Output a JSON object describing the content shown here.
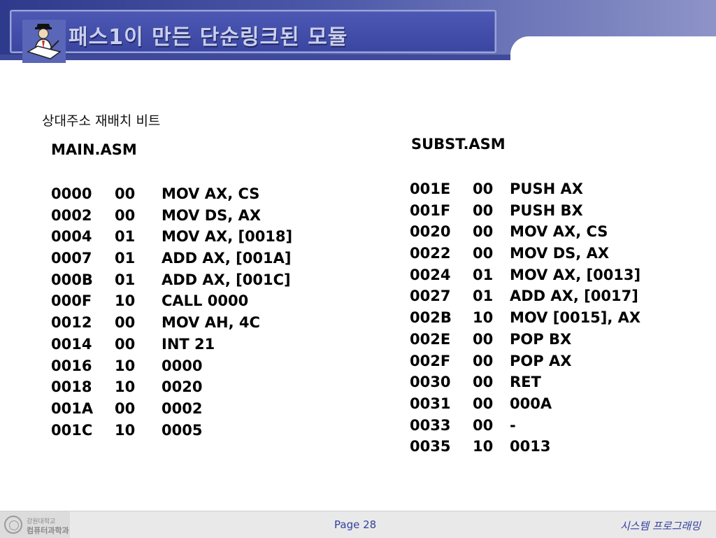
{
  "header": {
    "title": "패스1이 만든 단순링크된 모듈"
  },
  "subtitle": "상대주소  재배치 비트",
  "main_asm": {
    "title": "MAIN.ASM",
    "rows": [
      [
        "0000",
        "00",
        "MOV AX, CS"
      ],
      [
        "0002",
        "00",
        "MOV DS, AX"
      ],
      [
        "0004",
        "01",
        "MOV AX, [0018]"
      ],
      [
        "0007",
        "01",
        "ADD AX, [001A]"
      ],
      [
        "000B",
        "01",
        "ADD AX, [001C]"
      ],
      [
        "000F",
        "10",
        "CALL 0000"
      ],
      [
        "0012",
        "00",
        "MOV AH, 4C"
      ],
      [
        "0014",
        "00",
        "INT 21"
      ],
      [
        "0016",
        "10",
        "0000"
      ],
      [
        "0018",
        "10",
        "0020"
      ],
      [
        "001A",
        "00",
        "0002"
      ],
      [
        "001C",
        "10",
        "0005"
      ]
    ]
  },
  "subst_asm": {
    "title": "SUBST.ASM",
    "rows": [
      [
        "001E",
        "00",
        "PUSH AX"
      ],
      [
        "001F",
        "00",
        "PUSH BX"
      ],
      [
        "0020",
        "00",
        "MOV AX, CS"
      ],
      [
        "0022",
        "00",
        "MOV DS, AX"
      ],
      [
        "0024",
        "01",
        "MOV AX, [0013]"
      ],
      [
        "0027",
        "01",
        "ADD AX, [0017]"
      ],
      [
        "002B",
        "10",
        "MOV [0015], AX"
      ],
      [
        "002E",
        "00",
        "POP BX"
      ],
      [
        "002F",
        "00",
        "POP AX"
      ],
      [
        "0030",
        "00",
        "RET"
      ],
      [
        "0031",
        "00",
        "000A"
      ],
      [
        "0033",
        "00",
        "-"
      ],
      [
        "0035",
        "10",
        "0013"
      ]
    ]
  },
  "footer": {
    "brand_line1": "강원대학교",
    "brand_line2": "컴퓨터과학과",
    "page": "Page 28",
    "course": "시스템  프로그래밍"
  },
  "colors": {
    "header_blue": "#3a46a0",
    "footer_text": "#3240a0"
  },
  "icons": {
    "logo": "person-writing-icon",
    "seal": "university-seal-icon"
  }
}
